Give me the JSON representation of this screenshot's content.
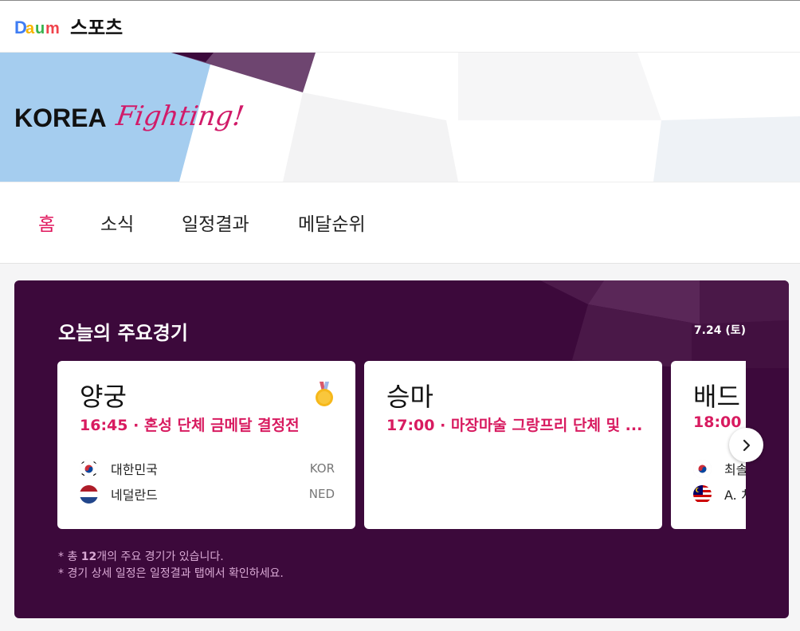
{
  "header": {
    "logo_text": "Daum",
    "title": "스포츠"
  },
  "banner": {
    "text_main": "KOREA",
    "text_accent": "Fighting!"
  },
  "nav": {
    "tabs": [
      {
        "label": "홈",
        "active": true
      },
      {
        "label": "소식",
        "active": false
      },
      {
        "label": "일정결과",
        "active": false
      },
      {
        "label": "메달순위",
        "active": false
      }
    ]
  },
  "today": {
    "title": "오늘의 주요경기",
    "date": "7.24 (토)",
    "cards": [
      {
        "sport": "양궁",
        "time_event": "16:45 · 혼성 단체 금메달 결정전",
        "medal_icon": "gold-medal-icon",
        "teams": [
          {
            "name": "대한민국",
            "code": "KOR",
            "flag": "korea-flag-icon"
          },
          {
            "name": "네덜란드",
            "code": "NED",
            "flag": "netherlands-flag-icon"
          }
        ]
      },
      {
        "sport": "승마",
        "time_event": "17:00 · 마장마술 그랑프리 단체 및 ...",
        "teams": []
      },
      {
        "sport": "배드",
        "time_event": "18:00 ·",
        "teams": [
          {
            "name": "최솔",
            "code": "",
            "flag": "korea-flag-icon"
          },
          {
            "name": "A. 치",
            "code": "",
            "flag": "malaysia-flag-icon"
          }
        ]
      }
    ],
    "note_line1_prefix": "* 총 ",
    "note_count": "12",
    "note_line1_suffix": "개의 주요 경기가 있습니다.",
    "note_line2": "* 경기 상세 일정은 일정결과 탭에서 확인하세요."
  },
  "colors": {
    "accent": "#e0175d",
    "panel_bg": "#3c093b",
    "time_text": "#d81b60"
  }
}
